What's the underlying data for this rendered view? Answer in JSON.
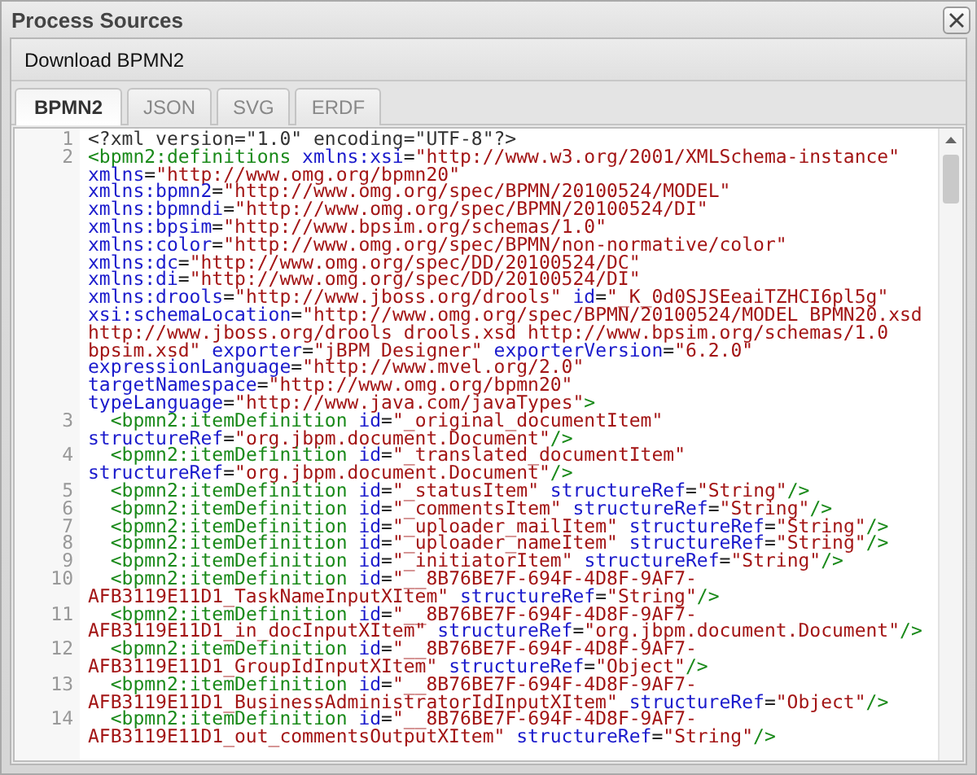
{
  "window": {
    "title": "Process Sources"
  },
  "toolbar": {
    "buttons": [
      "Download BPMN2"
    ]
  },
  "tabs": [
    {
      "label": "BPMN2",
      "selected": true
    },
    {
      "label": "JSON",
      "selected": false
    },
    {
      "label": "SVG",
      "selected": false
    },
    {
      "label": "ERDF",
      "selected": false
    }
  ],
  "editor": {
    "lines": [
      {
        "number": "1",
        "tokens": [
          {
            "kind": "plain",
            "text": "<?xml version=\"1.0\" encoding=\"UTF-8\"?>"
          }
        ]
      },
      {
        "number": "2",
        "tokens": [
          {
            "kind": "tag",
            "text": "<bpmn2:definitions"
          },
          {
            "kind": "attr",
            "text": " xmlns:xsi"
          },
          {
            "kind": "punct",
            "text": "="
          },
          {
            "kind": "value",
            "text": "\"http://www.w3.org/2001/XMLSchema-instance\""
          },
          {
            "kind": "attr",
            "text": " xmlns"
          },
          {
            "kind": "punct",
            "text": "="
          },
          {
            "kind": "value",
            "text": "\"http://www.omg.org/bpmn20\""
          },
          {
            "kind": "attr",
            "text": " xmlns:bpmn2"
          },
          {
            "kind": "punct",
            "text": "="
          },
          {
            "kind": "value",
            "text": "\"http://www.omg.org/spec/BPMN/20100524/MODEL\""
          },
          {
            "kind": "attr",
            "text": " xmlns:bpmndi"
          },
          {
            "kind": "punct",
            "text": "="
          },
          {
            "kind": "value",
            "text": "\"http://www.omg.org/spec/BPMN/20100524/DI\""
          },
          {
            "kind": "attr",
            "text": " xmlns:bpsim"
          },
          {
            "kind": "punct",
            "text": "="
          },
          {
            "kind": "value",
            "text": "\"http://www.bpsim.org/schemas/1.0\""
          },
          {
            "kind": "attr",
            "text": " xmlns:color"
          },
          {
            "kind": "punct",
            "text": "="
          },
          {
            "kind": "value",
            "text": "\"http://www.omg.org/spec/BPMN/non-normative/color\""
          },
          {
            "kind": "attr",
            "text": " xmlns:dc"
          },
          {
            "kind": "punct",
            "text": "="
          },
          {
            "kind": "value",
            "text": "\"http://www.omg.org/spec/DD/20100524/DC\""
          },
          {
            "kind": "attr",
            "text": " xmlns:di"
          },
          {
            "kind": "punct",
            "text": "="
          },
          {
            "kind": "value",
            "text": "\"http://www.omg.org/spec/DD/20100524/DI\""
          },
          {
            "kind": "attr",
            "text": " xmlns:drools"
          },
          {
            "kind": "punct",
            "text": "="
          },
          {
            "kind": "value",
            "text": "\"http://www.jboss.org/drools\""
          },
          {
            "kind": "attr",
            "text": " id"
          },
          {
            "kind": "punct",
            "text": "="
          },
          {
            "kind": "value",
            "text": "\"_K_0d0SJSEeaiTZHCI6pl5g\""
          },
          {
            "kind": "attr",
            "text": " xsi:schemaLocation"
          },
          {
            "kind": "punct",
            "text": "="
          },
          {
            "kind": "value",
            "text": "\"http://www.omg.org/spec/BPMN/20100524/MODEL BPMN20.xsd http://www.jboss.org/drools drools.xsd http://www.bpsim.org/schemas/1.0 bpsim.xsd\""
          },
          {
            "kind": "attr",
            "text": " exporter"
          },
          {
            "kind": "punct",
            "text": "="
          },
          {
            "kind": "value",
            "text": "\"jBPM Designer\""
          },
          {
            "kind": "attr",
            "text": " exporterVersion"
          },
          {
            "kind": "punct",
            "text": "="
          },
          {
            "kind": "value",
            "text": "\"6.2.0\""
          },
          {
            "kind": "attr",
            "text": " expressionLanguage"
          },
          {
            "kind": "punct",
            "text": "="
          },
          {
            "kind": "value",
            "text": "\"http://www.mvel.org/2.0\""
          },
          {
            "kind": "attr",
            "text": " targetNamespace"
          },
          {
            "kind": "punct",
            "text": "="
          },
          {
            "kind": "value",
            "text": "\"http://www.omg.org/bpmn20\""
          },
          {
            "kind": "attr",
            "text": " typeLanguage"
          },
          {
            "kind": "punct",
            "text": "="
          },
          {
            "kind": "value",
            "text": "\"http://www.java.com/javaTypes\""
          },
          {
            "kind": "tag",
            "text": ">"
          }
        ]
      },
      {
        "number": "3",
        "tokens": [
          {
            "kind": "tag",
            "text": "  <bpmn2:itemDefinition"
          },
          {
            "kind": "attr",
            "text": " id"
          },
          {
            "kind": "punct",
            "text": "="
          },
          {
            "kind": "value",
            "text": "\"_original_documentItem\""
          },
          {
            "kind": "attr",
            "text": " structureRef"
          },
          {
            "kind": "punct",
            "text": "="
          },
          {
            "kind": "value",
            "text": "\"org.jbpm.document.Document\""
          },
          {
            "kind": "tag",
            "text": "/>"
          }
        ]
      },
      {
        "number": "4",
        "tokens": [
          {
            "kind": "tag",
            "text": "  <bpmn2:itemDefinition"
          },
          {
            "kind": "attr",
            "text": " id"
          },
          {
            "kind": "punct",
            "text": "="
          },
          {
            "kind": "value",
            "text": "\"_translated_documentItem\""
          },
          {
            "kind": "attr",
            "text": " structureRef"
          },
          {
            "kind": "punct",
            "text": "="
          },
          {
            "kind": "value",
            "text": "\"org.jbpm.document.Document\""
          },
          {
            "kind": "tag",
            "text": "/>"
          }
        ]
      },
      {
        "number": "5",
        "tokens": [
          {
            "kind": "tag",
            "text": "  <bpmn2:itemDefinition"
          },
          {
            "kind": "attr",
            "text": " id"
          },
          {
            "kind": "punct",
            "text": "="
          },
          {
            "kind": "value",
            "text": "\"_statusItem\""
          },
          {
            "kind": "attr",
            "text": " structureRef"
          },
          {
            "kind": "punct",
            "text": "="
          },
          {
            "kind": "value",
            "text": "\"String\""
          },
          {
            "kind": "tag",
            "text": "/>"
          }
        ]
      },
      {
        "number": "6",
        "tokens": [
          {
            "kind": "tag",
            "text": "  <bpmn2:itemDefinition"
          },
          {
            "kind": "attr",
            "text": " id"
          },
          {
            "kind": "punct",
            "text": "="
          },
          {
            "kind": "value",
            "text": "\"_commentsItem\""
          },
          {
            "kind": "attr",
            "text": " structureRef"
          },
          {
            "kind": "punct",
            "text": "="
          },
          {
            "kind": "value",
            "text": "\"String\""
          },
          {
            "kind": "tag",
            "text": "/>"
          }
        ]
      },
      {
        "number": "7",
        "tokens": [
          {
            "kind": "tag",
            "text": "  <bpmn2:itemDefinition"
          },
          {
            "kind": "attr",
            "text": " id"
          },
          {
            "kind": "punct",
            "text": "="
          },
          {
            "kind": "value",
            "text": "\"_uploader_mailItem\""
          },
          {
            "kind": "attr",
            "text": " structureRef"
          },
          {
            "kind": "punct",
            "text": "="
          },
          {
            "kind": "value",
            "text": "\"String\""
          },
          {
            "kind": "tag",
            "text": "/>"
          }
        ]
      },
      {
        "number": "8",
        "tokens": [
          {
            "kind": "tag",
            "text": "  <bpmn2:itemDefinition"
          },
          {
            "kind": "attr",
            "text": " id"
          },
          {
            "kind": "punct",
            "text": "="
          },
          {
            "kind": "value",
            "text": "\"_uploader_nameItem\""
          },
          {
            "kind": "attr",
            "text": " structureRef"
          },
          {
            "kind": "punct",
            "text": "="
          },
          {
            "kind": "value",
            "text": "\"String\""
          },
          {
            "kind": "tag",
            "text": "/>"
          }
        ]
      },
      {
        "number": "9",
        "tokens": [
          {
            "kind": "tag",
            "text": "  <bpmn2:itemDefinition"
          },
          {
            "kind": "attr",
            "text": " id"
          },
          {
            "kind": "punct",
            "text": "="
          },
          {
            "kind": "value",
            "text": "\"_initiatorItem\""
          },
          {
            "kind": "attr",
            "text": " structureRef"
          },
          {
            "kind": "punct",
            "text": "="
          },
          {
            "kind": "value",
            "text": "\"String\""
          },
          {
            "kind": "tag",
            "text": "/>"
          }
        ]
      },
      {
        "number": "10",
        "tokens": [
          {
            "kind": "tag",
            "text": "  <bpmn2:itemDefinition"
          },
          {
            "kind": "attr",
            "text": " id"
          },
          {
            "kind": "punct",
            "text": "="
          },
          {
            "kind": "value",
            "text": "\"__8B76BE7F-694F-4D8F-9AF7-AFB3119E11D1_TaskNameInputXItem\""
          },
          {
            "kind": "attr",
            "text": " structureRef"
          },
          {
            "kind": "punct",
            "text": "="
          },
          {
            "kind": "value",
            "text": "\"String\""
          },
          {
            "kind": "tag",
            "text": "/>"
          }
        ]
      },
      {
        "number": "11",
        "tokens": [
          {
            "kind": "tag",
            "text": "  <bpmn2:itemDefinition"
          },
          {
            "kind": "attr",
            "text": " id"
          },
          {
            "kind": "punct",
            "text": "="
          },
          {
            "kind": "value",
            "text": "\"__8B76BE7F-694F-4D8F-9AF7-AFB3119E11D1_in_docInputXItem\""
          },
          {
            "kind": "attr",
            "text": " structureRef"
          },
          {
            "kind": "punct",
            "text": "="
          },
          {
            "kind": "value",
            "text": "\"org.jbpm.document.Document\""
          },
          {
            "kind": "tag",
            "text": "/>"
          }
        ]
      },
      {
        "number": "12",
        "tokens": [
          {
            "kind": "tag",
            "text": "  <bpmn2:itemDefinition"
          },
          {
            "kind": "attr",
            "text": " id"
          },
          {
            "kind": "punct",
            "text": "="
          },
          {
            "kind": "value",
            "text": "\"__8B76BE7F-694F-4D8F-9AF7-AFB3119E11D1_GroupIdInputXItem\""
          },
          {
            "kind": "attr",
            "text": " structureRef"
          },
          {
            "kind": "punct",
            "text": "="
          },
          {
            "kind": "value",
            "text": "\"Object\""
          },
          {
            "kind": "tag",
            "text": "/>"
          }
        ]
      },
      {
        "number": "13",
        "tokens": [
          {
            "kind": "tag",
            "text": "  <bpmn2:itemDefinition"
          },
          {
            "kind": "attr",
            "text": " id"
          },
          {
            "kind": "punct",
            "text": "="
          },
          {
            "kind": "value",
            "text": "\"__8B76BE7F-694F-4D8F-9AF7-AFB3119E11D1_BusinessAdministratorIdInputXItem\""
          },
          {
            "kind": "attr",
            "text": " structureRef"
          },
          {
            "kind": "punct",
            "text": "="
          },
          {
            "kind": "value",
            "text": "\"Object\""
          },
          {
            "kind": "tag",
            "text": "/>"
          }
        ]
      },
      {
        "number": "14",
        "tokens": [
          {
            "kind": "tag",
            "text": "  <bpmn2:itemDefinition"
          },
          {
            "kind": "attr",
            "text": " id"
          },
          {
            "kind": "punct",
            "text": "="
          },
          {
            "kind": "value",
            "text": "\"__8B76BE7F-694F-4D8F-9AF7-AFB3119E11D1_out_commentsOutputXItem\""
          },
          {
            "kind": "attr",
            "text": " structureRef"
          },
          {
            "kind": "punct",
            "text": "="
          },
          {
            "kind": "value",
            "text": "\"String\""
          },
          {
            "kind": "tag",
            "text": "/>"
          }
        ]
      }
    ]
  }
}
